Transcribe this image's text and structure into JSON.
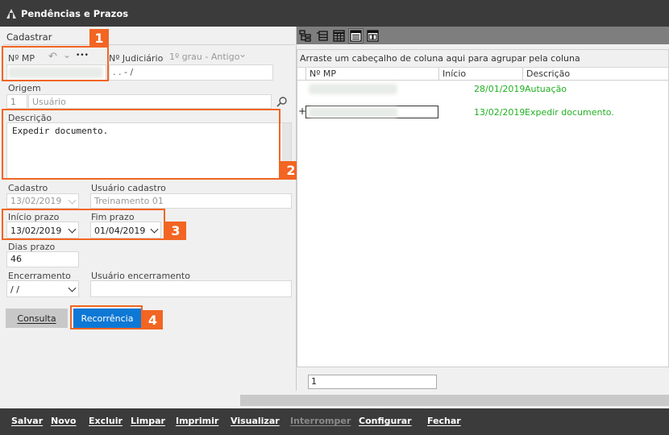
{
  "window": {
    "title": "Pendências e Prazos"
  },
  "form": {
    "section_title": "Cadastrar",
    "nmp_label": "Nº MP",
    "nmp_actions": [
      "↶",
      "⌄",
      "•••"
    ],
    "judicial_label": "Nº Judiciário",
    "judicial_instance": "1º grau - Antigo",
    "judicial_value": ". .    - /",
    "origem_label": "Origem",
    "origem_code": "1",
    "origem_value": "Usuário",
    "descricao_label": "Descrição",
    "descricao_value": "Expedir documento.",
    "cadastro_label": "Cadastro",
    "cadastro_value": "13/02/2019",
    "usuario_cadastro_label": "Usuário cadastro",
    "usuario_cadastro_value": "Treinamento 01",
    "inicio_label": "Início prazo",
    "inicio_value": "13/02/2019",
    "fim_label": "Fim prazo",
    "fim_value": "01/04/2019",
    "dias_label": "Dias prazo",
    "dias_value": "46",
    "encerramento_label": "Encerramento",
    "encerramento_value": " / /",
    "usuario_encerramento_label": "Usuário encerramento",
    "usuario_encerramento_value": "",
    "consulta_label": "Consulta",
    "recorrencia_label": "Recorrência"
  },
  "callouts": [
    "1",
    "2",
    "3",
    "4"
  ],
  "grid": {
    "group_hint": "Arraste um cabeçalho de coluna aqui para agrupar pela coluna",
    "columns": [
      "Nº MP",
      "Início",
      "Descrição"
    ],
    "rows": [
      {
        "expander": "",
        "inicio": "28/01/2019",
        "descricao": "Autuação"
      },
      {
        "expander": "+",
        "inicio": "13/02/2019",
        "descricao": "Expedir documento."
      }
    ],
    "footer_value": "1",
    "toolbar_icons": [
      "tree-view-icon",
      "group-view-icon",
      "table-view-icon",
      "list-view-icon",
      "card-view-icon"
    ]
  },
  "menu": {
    "items": [
      "Salvar",
      "Novo",
      "Excluir",
      "Limpar",
      "Imprimir",
      "Visualizar",
      "Interromper",
      "Configurar",
      "Fechar"
    ]
  },
  "colors": {
    "callout": "#f26522",
    "primary_button": "#0e78d5",
    "green_text": "#22b022",
    "bar": "#3b3b3b"
  }
}
